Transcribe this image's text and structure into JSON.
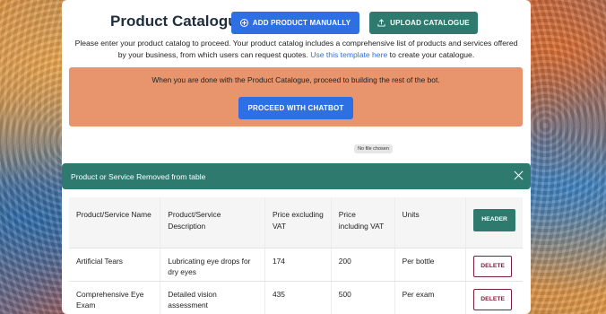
{
  "page": {
    "title": "Product Catalogue",
    "add_button_label": "ADD PRODUCT MANUALLY",
    "upload_button_label": "UPLOAD CATALOGUE",
    "intro_text": "Please enter your product catalog to proceed. Your product catalog includes a comprehensive list of products and services offered by your business, from which users can request quotes.",
    "template_link_text": "Use this template here",
    "intro_suffix": "to create your catalogue."
  },
  "notice": {
    "text": "When you are done with the Product Catalogue, proceed to building the rest of the bot.",
    "proceed_button_label": "PROCEED WITH CHATBOT"
  },
  "file_input": {
    "status_text": "No file chosen"
  },
  "toast": {
    "message": "Product or Service Removed from table"
  },
  "table": {
    "headers": {
      "name": "Product/Service Name",
      "description": "Product/Service Description",
      "price_ex": "Price excluding VAT",
      "price_inc": "Price including VAT",
      "units": "Units",
      "action_button": "HEADER"
    },
    "rows": [
      {
        "name": "Artificial Tears",
        "description": "Lubricating eye drops for dry eyes",
        "price_ex": "174",
        "price_inc": "200",
        "units": "Per bottle",
        "action": "DELETE"
      },
      {
        "name": "Comprehensive Eye Exam",
        "description": "Detailed vision assessment",
        "price_ex": "435",
        "price_inc": "500",
        "units": "Per exam",
        "action": "DELETE"
      }
    ]
  },
  "colors": {
    "primary_blue": "#2f6fe4",
    "teal": "#2f7a6f",
    "notice_bg": "#e8956d",
    "delete_border": "#7a1e3a"
  }
}
